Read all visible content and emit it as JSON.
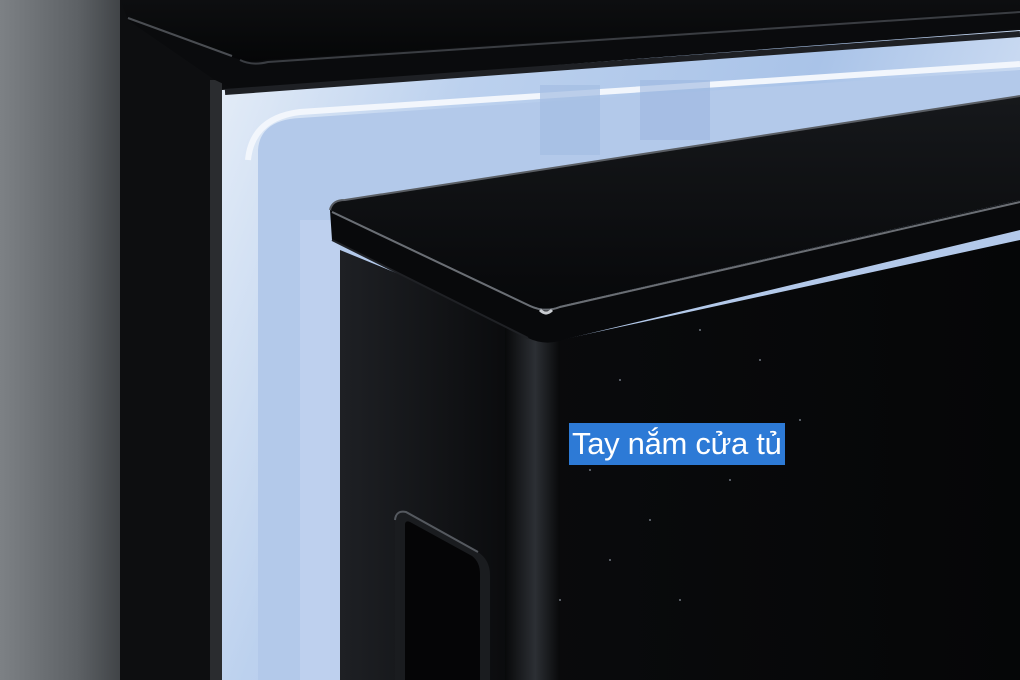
{
  "photo": {
    "caption": "Tay nắm cửa tủ"
  },
  "colors": {
    "caption_background": "#2d7ad6",
    "caption_text": "#ffffff",
    "interior_light": "#c8daf2",
    "door_black": "#08090b",
    "left_panel_gray": "#6e7276"
  }
}
